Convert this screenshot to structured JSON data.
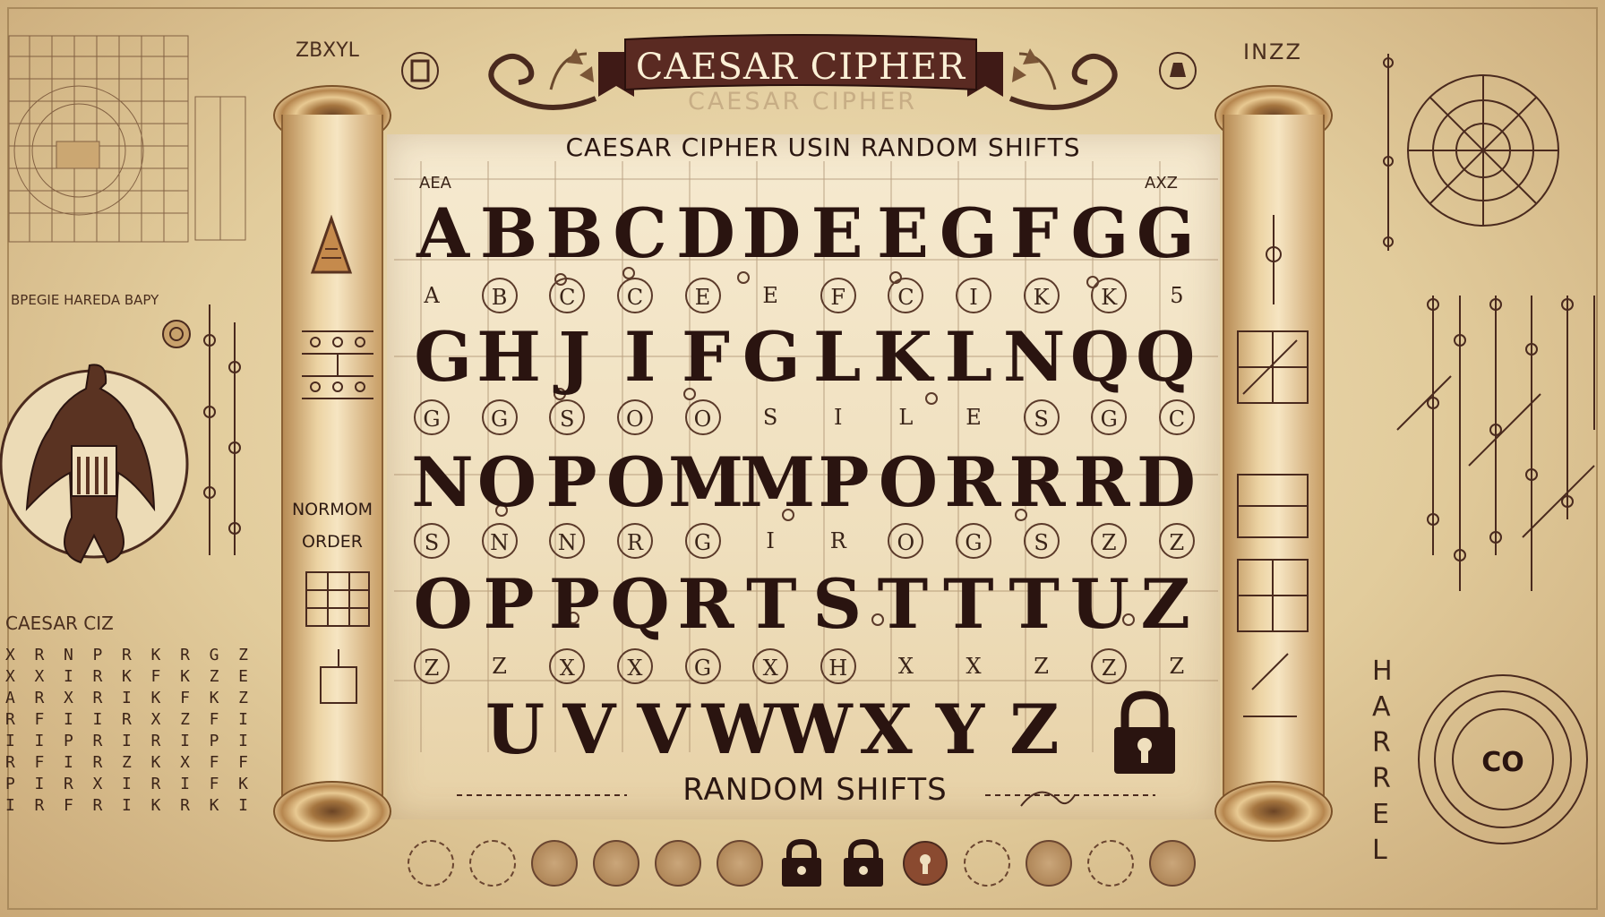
{
  "banner": {
    "title": "CAESAR CIPHER",
    "ghost": "CAESAR CIPHER"
  },
  "subtitle": "CAESAR CIPHER USIN RANDOM SHIFTS",
  "corners": {
    "left": "AEA",
    "right": "AXZ",
    "top_left": "ZBXYL",
    "top_right": "INZZ",
    "left_band": "BPEGIE HAREDA BAPY"
  },
  "rows": [
    {
      "big": [
        "A",
        "B",
        "B",
        "C",
        "D",
        "D",
        "E",
        "E",
        "G",
        "F",
        "G",
        "G"
      ],
      "small": [
        "A",
        "B",
        "C",
        "C",
        "E",
        "E",
        "F",
        "C",
        "I",
        "K",
        "K",
        "5"
      ]
    },
    {
      "big": [
        "G",
        "H",
        "J",
        "I",
        "F",
        "G",
        "L",
        "K",
        "L",
        "N",
        "Q",
        "Q"
      ],
      "small": [
        "G",
        "G",
        "S",
        "O",
        "O",
        "S",
        "I",
        "L",
        "E",
        "S",
        "G",
        "C"
      ]
    },
    {
      "big": [
        "N",
        "O",
        "P",
        "O",
        "M",
        "M",
        "P",
        "O",
        "R",
        "R",
        "R",
        "D"
      ],
      "small": [
        "S",
        "N",
        "N",
        "R",
        "G",
        "I",
        "R",
        "O",
        "G",
        "S",
        "Z",
        "Z"
      ]
    },
    {
      "big": [
        "O",
        "P",
        "P",
        "Q",
        "R",
        "T",
        "S",
        "T",
        "T",
        "T",
        "U",
        "Z"
      ],
      "small": [
        "Z",
        "Z",
        "X",
        "X",
        "G",
        "X",
        "H",
        "X",
        "X",
        "Z",
        "Z",
        "Z"
      ]
    }
  ],
  "last_row": [
    "U",
    "V",
    "V",
    "W",
    "W",
    "X",
    "Y",
    "Z"
  ],
  "footer": "RANDOM SHIFTS",
  "left_scroll": {
    "label_line1": "NORMOM",
    "label_line2": "ORDER"
  },
  "left_side": {
    "caption": "CAESAR CIZ"
  },
  "right_side": {
    "seal_text": "CO",
    "vertical_letters": "HARREL"
  },
  "colors": {
    "parchment": "#f1e2bd",
    "ink": "#2a1410",
    "banner": "#5a2a22"
  }
}
